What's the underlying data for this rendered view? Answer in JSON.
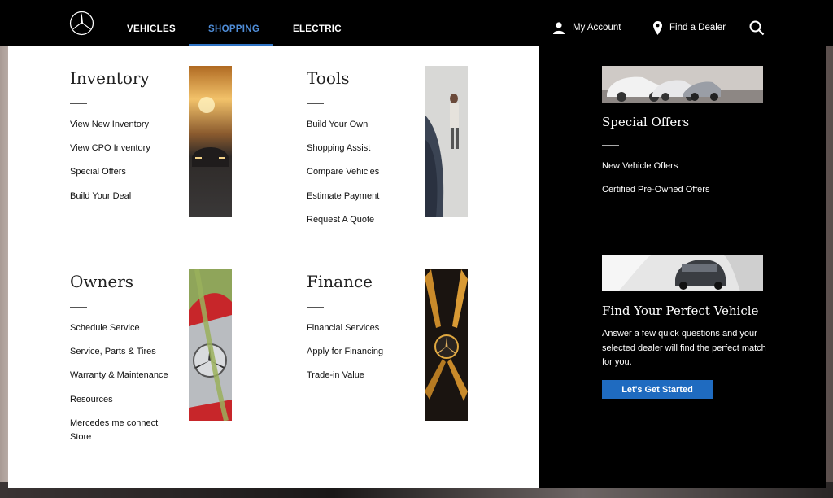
{
  "nav": {
    "links": [
      "VEHICLES",
      "SHOPPING",
      "ELECTRIC"
    ],
    "my_account": "My Account",
    "find_dealer": "Find a Dealer"
  },
  "sections": {
    "inventory": {
      "title": "Inventory",
      "items": [
        "View New Inventory",
        "View CPO Inventory",
        "Special Offers",
        "Build Your Deal"
      ]
    },
    "tools": {
      "title": "Tools",
      "items": [
        "Build Your Own",
        "Shopping Assist",
        "Compare Vehicles",
        "Estimate Payment",
        "Request A Quote"
      ]
    },
    "owners": {
      "title": "Owners",
      "items": [
        "Schedule Service",
        "Service, Parts & Tires",
        "Warranty & Maintenance",
        "Resources",
        "Mercedes me connect Store"
      ]
    },
    "finance": {
      "title": "Finance",
      "items": [
        "Financial Services",
        "Apply for Financing",
        "Trade-in Value"
      ]
    }
  },
  "side": {
    "offers_title": "Special Offers",
    "offers_links": [
      "New Vehicle Offers",
      "Certified Pre-Owned Offers"
    ],
    "find_title": "Find Your Perfect Vehicle",
    "find_text": "Answer a few quick questions and your selected dealer will find the perfect match for you.",
    "cta": "Let's Get Started"
  },
  "colors": {
    "accent": "#2f73c4",
    "nav_bg": "#000000",
    "cta": "#1f6bc0"
  }
}
